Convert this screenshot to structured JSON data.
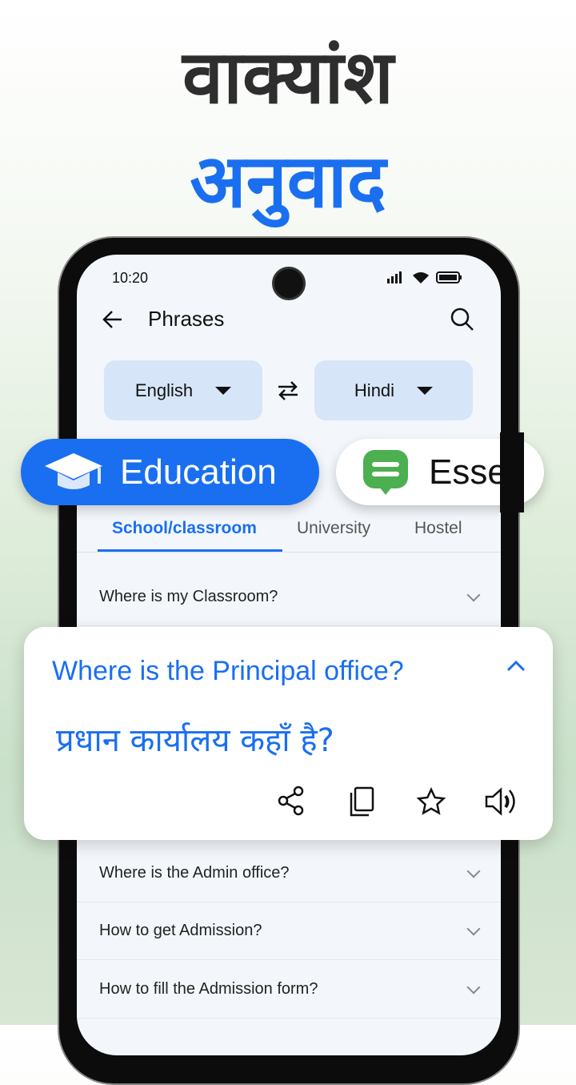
{
  "headline": {
    "line1": "वाक्यांश",
    "line2": "अनुवाद"
  },
  "status": {
    "time": "10:20"
  },
  "header": {
    "title": "Phrases"
  },
  "languages": {
    "source": "English",
    "target": "Hindi"
  },
  "categories": [
    {
      "label": "Education",
      "icon": "graduation-cap-icon"
    },
    {
      "label": "Esse",
      "icon": "chat-bubble-icon"
    }
  ],
  "subtabs": [
    {
      "label": "School/classroom",
      "active": true
    },
    {
      "label": "University"
    },
    {
      "label": "Hostel"
    }
  ],
  "phrases": [
    "Where is my Classroom?",
    "Where is the Admin office?",
    "How to get Admission?",
    "How to fill the Admission form?"
  ],
  "expanded": {
    "english": "Where is the Principal office?",
    "hindi": "प्रधान कार्यालय कहाँ है?"
  },
  "colors": {
    "accent": "#1a6ff0",
    "green": "#4caf50"
  }
}
